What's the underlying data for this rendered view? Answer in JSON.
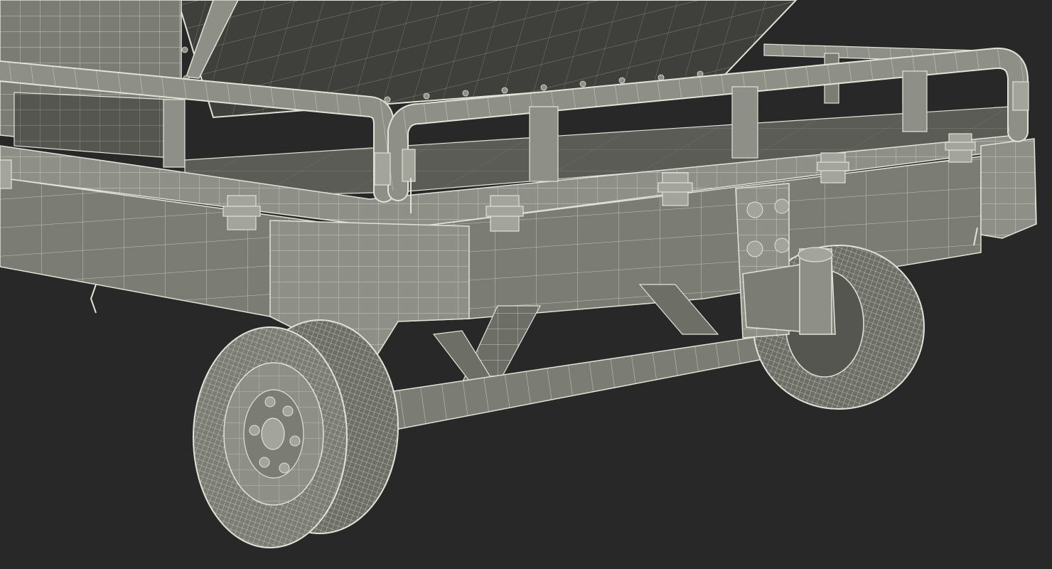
{
  "scene": {
    "subject": "wireframe-render-flatbed-trailer-with-solar-panel",
    "colors": {
      "background": "#282828",
      "body_fill": "#7b7c73",
      "body_fill_dark": "#62635b",
      "body_fill_light": "#8e8f86",
      "panel_fill": "#3f403c",
      "wire": "#e2e2d6",
      "wire_dim": "#bdbdb1",
      "tire_fill": "#6d6e66",
      "shadow_fill": "#55564f"
    }
  }
}
